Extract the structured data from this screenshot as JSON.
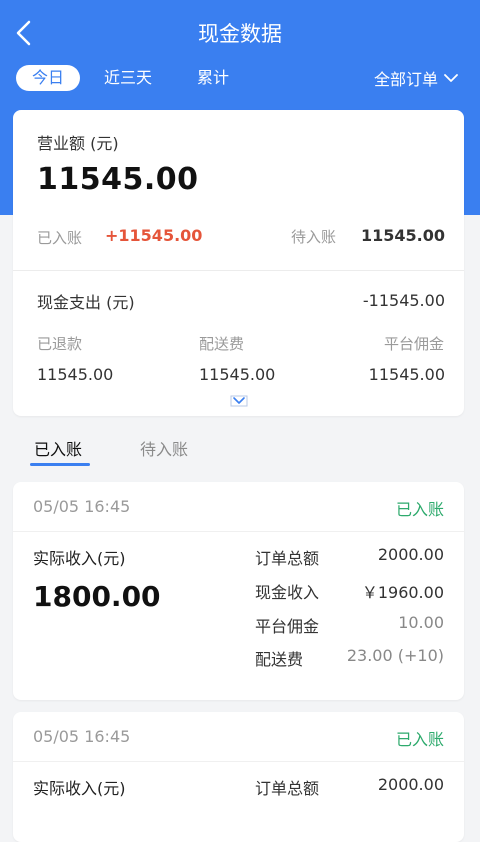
{
  "title": "现金数据",
  "tabs": {
    "today": "今日",
    "three_days": "近三天",
    "cumulative": "累计"
  },
  "filter": {
    "label": "全部订单"
  },
  "summary": {
    "revenue_label": "营业额 (元)",
    "revenue_value": "11545.00",
    "credited_label": "已入账",
    "credited_value": "+11545.00",
    "pending_label": "待入账",
    "pending_value": "11545.00",
    "cash_out_label": "现金支出 (元)",
    "cash_out_value": "-11545.00",
    "refunded_label": "已退款",
    "refunded_value": "11545.00",
    "delivery_label": "配送费",
    "delivery_value": "11545.00",
    "commission_label": "平台佣金",
    "commission_value": "11545.00"
  },
  "segments": {
    "credited": "已入账",
    "pending": "待入账"
  },
  "orders": [
    {
      "time": "05/05  16:45",
      "status": "已入账",
      "income_label": "实际收入(元)",
      "income": "1800.00",
      "total_label": "订单总额",
      "total": "2000.00",
      "cash_label": "现金收入",
      "cash": "￥1960.00",
      "commission_label": "平台佣金",
      "commission": "10.00",
      "delivery_label": "配送费",
      "delivery": "23.00 (+10)"
    },
    {
      "time": "05/05  16:45",
      "status": "已入账",
      "income_label": "实际收入(元)",
      "total_label": "订单总额",
      "total": "2000.00"
    }
  ],
  "colors": {
    "primary": "#3a7ff0",
    "credited_red": "#e5553a",
    "status_green": "#2eaa6d"
  }
}
